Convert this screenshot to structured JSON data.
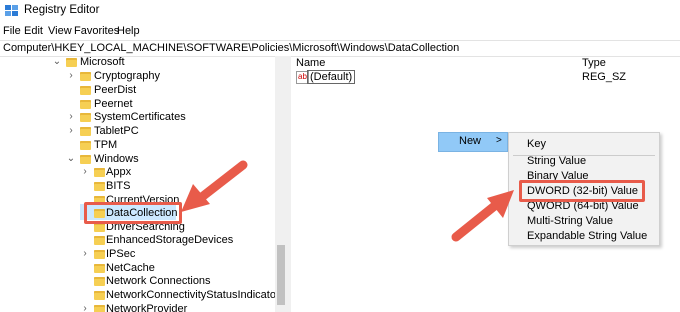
{
  "window": {
    "title": "Registry Editor"
  },
  "menu": [
    "File",
    "Edit",
    "View",
    "Favorites",
    "Help"
  ],
  "address": "Computer\\HKEY_LOCAL_MACHINE\\SOFTWARE\\Policies\\Microsoft\\Windows\\DataCollection",
  "tree": {
    "microsoft": "Microsoft",
    "cryptography": "Cryptography",
    "peerdist": "PeerDist",
    "peernet": "Peernet",
    "systemcertificates": "SystemCertificates",
    "tabletpc": "TabletPC",
    "tpm": "TPM",
    "windows": "Windows",
    "appx": "Appx",
    "bits": "BITS",
    "currentversion": "CurrentVersion",
    "datacollection": "DataCollection",
    "driversearching": "DriverSearching",
    "enhancedstorage": "EnhancedStorageDevices",
    "ipsec": "IPSec",
    "netcache": "NetCache",
    "networkconnections": "Network Connections",
    "ncsi": "NetworkConnectivityStatusIndicator",
    "networkprovider": "NetworkProvider"
  },
  "list": {
    "col_name": "Name",
    "col_type": "Type",
    "default_name": "(Default)",
    "default_type": "REG_SZ",
    "default_icon": "ab"
  },
  "context_menu": {
    "new_label": "New",
    "new_arrow": ">",
    "submenu": {
      "key": "Key",
      "string_value": "String Value",
      "binary_value": "Binary Value",
      "dword_value": "DWORD (32-bit) Value",
      "qword_value": "QWORD (64-bit) Value",
      "multi_string_value": "Multi-String Value",
      "expandable_string_value": "Expandable String Value"
    }
  },
  "colors": {
    "highlight": "#e85b4a",
    "selection": "#cce8ff",
    "new_item_bg": "#91c9f7",
    "folder": "#f6cf53"
  }
}
